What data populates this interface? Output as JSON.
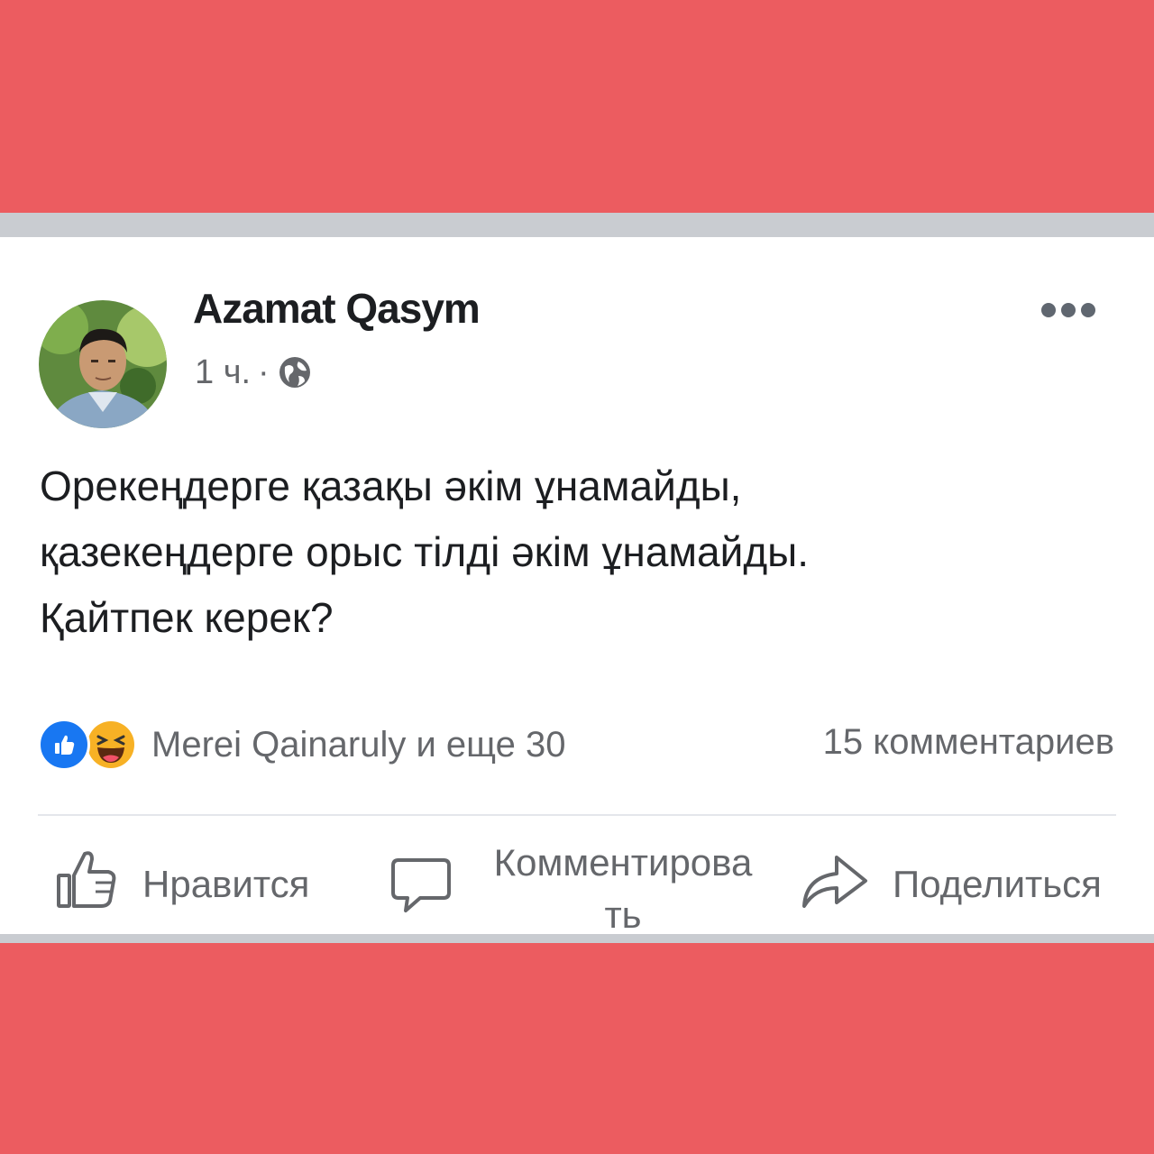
{
  "post": {
    "author": "Azamat Qasym",
    "time": "1 ч.",
    "separator": "·",
    "visibility_icon": "globe-icon",
    "more_icon": "more-horizontal-icon",
    "text_lines": [
      "Орекеңдерге қазақы әкім ұнамайды,",
      "қазекеңдерге орыс тілді әкім ұнамайды.",
      "Қайтпек керек?"
    ]
  },
  "reactions": {
    "icons": [
      "like-reaction-icon",
      "haha-reaction-icon"
    ],
    "names": "Merei Qainaruly и еще 30",
    "comments": "15 комментариев"
  },
  "actions": {
    "like_label": "Нравится",
    "comment_label_line1": "Комментирова",
    "comment_label_line2": "ть",
    "share_label": "Поделиться"
  },
  "colors": {
    "background": "#ec5c60",
    "card": "#ffffff",
    "frame": "#c9ccd1",
    "like_blue": "#1877f2",
    "text": "#1c1e21",
    "secondary_text": "#65676b"
  }
}
